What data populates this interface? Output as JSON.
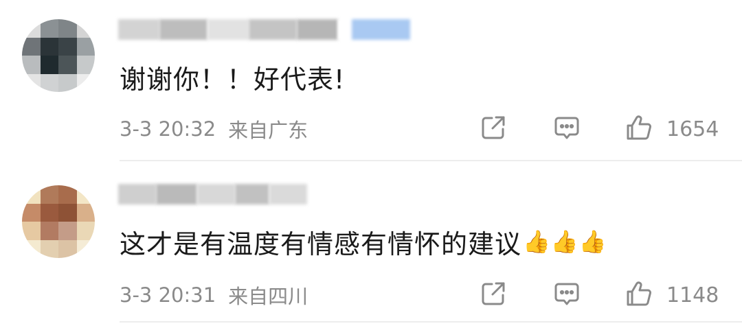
{
  "comments": [
    {
      "content": "谢谢你！！好代表!",
      "emoji": "",
      "date": "3-3 20:32",
      "location": "来自广东",
      "likes": "1654",
      "username_redacted": true,
      "avatar_pixelated": true
    },
    {
      "content": "这才是有温度有情感有情怀的建议",
      "emoji": "👍👍👍",
      "date": "3-3 20:31",
      "location": "来自四川",
      "likes": "1148",
      "username_redacted": true,
      "avatar_pixelated": true
    }
  ],
  "icons": {
    "share": "share-icon",
    "reply": "comment-icon",
    "like": "thumbs-up-icon"
  },
  "colors": {
    "text": "#1a1a1a",
    "meta": "#8a8a8a",
    "divider": "#ededed",
    "icon": "#8a8a8a"
  }
}
